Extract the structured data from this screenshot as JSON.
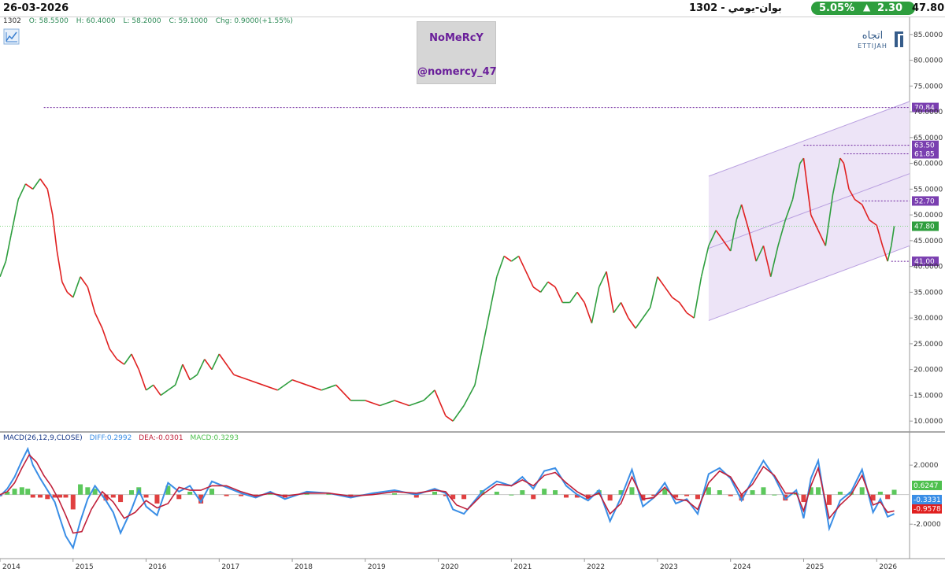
{
  "header": {
    "date": "26-03-2026",
    "symbol_code": "1302",
    "symbol_name": "بوان-يومي",
    "separator": "-",
    "change_pct": "5.05%",
    "change_value": "2.30",
    "last_price": "47.80"
  },
  "ohlc": {
    "symbol": "1302",
    "open": "O: 58.5500",
    "high": "H: 60.4000",
    "low": "L: 58.2000",
    "close": "C: 59.1000",
    "change": "Chg: 0.9000(+1.55%)"
  },
  "watermark": {
    "name": "NoMeRcY",
    "handle": "@nomercy_47"
  },
  "logo": {
    "arabic": "اتجاه",
    "latin": "ETTIJAH"
  },
  "macd_legend": {
    "title": "MACD(26,12,9,CLOSE)",
    "diff": "DIFF:0.2992",
    "dea": "DEA:-0.0301",
    "macd": "MACD:0.3293"
  },
  "colors": {
    "up": "#2e9e3e",
    "down": "#e02020",
    "level_line": "#6a1f9a",
    "channel_fill": "#ede4f7",
    "channel_line": "#b9a0e0",
    "diff_line": "#3a8ee6",
    "dea_line": "#c0203a",
    "badge_bg": "#2e9e3e"
  },
  "chart_data": [
    {
      "type": "line",
      "name": "price",
      "y_axis_ticks": [
        "85.0000",
        "80.0000",
        "75.0000",
        "70.0000",
        "65.0000",
        "60.0000",
        "55.0000",
        "50.0000",
        "45.0000",
        "40.0000",
        "35.0000",
        "30.0000",
        "25.0000",
        "20.0000",
        "15.0000",
        "10.0000"
      ],
      "ylim": [
        8.5,
        86.5
      ],
      "x_axis_labels": [
        "2014",
        "2015",
        "2016",
        "2017",
        "2018",
        "2019",
        "2020",
        "2021",
        "2022",
        "2023",
        "2024",
        "2025",
        "2026"
      ],
      "xlim": [
        2014.0,
        2026.45
      ],
      "series": [
        {
          "x": [
            2014.0,
            2014.08,
            2014.15,
            2014.25,
            2014.35,
            2014.45,
            2014.55,
            2014.65,
            2014.72,
            2014.78,
            2014.85,
            2014.92,
            2015.0,
            2015.1,
            2015.2,
            2015.3,
            2015.4,
            2015.5,
            2015.6,
            2015.7,
            2015.8,
            2015.9,
            2016.0,
            2016.1,
            2016.2,
            2016.3,
            2016.4,
            2016.5,
            2016.6,
            2016.7,
            2016.8,
            2016.9,
            2017.0,
            2017.2,
            2017.4,
            2017.6,
            2017.8,
            2018.0,
            2018.2,
            2018.4,
            2018.6,
            2018.8,
            2019.0,
            2019.2,
            2019.4,
            2019.6,
            2019.8,
            2019.95,
            2020.1,
            2020.2,
            2020.35,
            2020.5,
            2020.6,
            2020.7,
            2020.8,
            2020.9,
            2021.0,
            2021.1,
            2021.2,
            2021.3,
            2021.4,
            2021.5,
            2021.6,
            2021.7,
            2021.8,
            2021.9,
            2022.0,
            2022.1,
            2022.2,
            2022.3,
            2022.4,
            2022.5,
            2022.6,
            2022.7,
            2022.8,
            2022.9,
            2023.0,
            2023.1,
            2023.2,
            2023.3,
            2023.4,
            2023.5,
            2023.6,
            2023.7,
            2023.8,
            2023.9,
            2024.0,
            2024.08,
            2024.15,
            2024.25,
            2024.35,
            2024.45,
            2024.55,
            2024.65,
            2024.75,
            2024.85,
            2024.95,
            2025.0,
            2025.1,
            2025.2,
            2025.3,
            2025.4,
            2025.5,
            2025.55,
            2025.62,
            2025.7,
            2025.8,
            2025.9,
            2026.0,
            2026.08,
            2026.15,
            2026.2,
            2026.24
          ],
          "y": [
            38,
            41,
            46,
            53,
            56,
            55,
            57,
            55,
            50,
            43,
            37,
            35,
            34,
            38,
            36,
            31,
            28,
            24,
            22,
            21,
            23,
            20,
            16,
            17,
            15,
            16,
            17,
            21,
            18,
            19,
            22,
            20,
            23,
            19,
            18,
            17,
            16,
            18,
            17,
            16,
            17,
            14,
            14,
            13,
            14,
            13,
            14,
            16,
            11,
            10,
            13,
            17,
            24,
            31,
            38,
            42,
            41,
            42,
            39,
            36,
            35,
            37,
            36,
            33,
            33,
            35,
            33,
            29,
            36,
            39,
            31,
            33,
            30,
            28,
            30,
            32,
            38,
            36,
            34,
            33,
            31,
            30,
            38,
            44,
            47,
            45,
            43,
            49,
            52,
            47,
            41,
            44,
            38,
            44,
            49,
            53,
            60,
            61,
            50,
            47,
            44,
            54,
            61,
            60,
            55,
            53,
            52,
            49,
            48,
            44,
            41,
            44,
            47.8
          ]
        }
      ],
      "levels": [
        70.84,
        63.5,
        61.85,
        52.7,
        47.8,
        41.0
      ],
      "channel": {
        "x": [
          2023.7,
          2026.45
        ],
        "lower": [
          29.5,
          44.0
        ],
        "mid": [
          43.5,
          58.0
        ],
        "upper": [
          57.5,
          72.0
        ]
      }
    },
    {
      "type": "line",
      "name": "MACD(26,12,9,CLOSE)",
      "y_axis_ticks": [
        "2.0000",
        "-2.0000"
      ],
      "ylim": [
        -3.8,
        3.5
      ],
      "xlim": [
        2014.0,
        2026.45
      ],
      "series": [
        {
          "name": "DIFF",
          "x": [
            2014.0,
            2014.1,
            2014.2,
            2014.3,
            2014.38,
            2014.45,
            2014.55,
            2014.65,
            2014.75,
            2014.82,
            2014.9,
            2015.0,
            2015.1,
            2015.2,
            2015.3,
            2015.45,
            2015.55,
            2015.65,
            2015.8,
            2015.9,
            2016.0,
            2016.15,
            2016.3,
            2016.45,
            2016.6,
            2016.75,
            2016.9,
            2017.1,
            2017.3,
            2017.5,
            2017.7,
            2017.9,
            2018.2,
            2018.5,
            2018.8,
            2019.1,
            2019.4,
            2019.7,
            2019.95,
            2020.1,
            2020.2,
            2020.35,
            2020.6,
            2020.8,
            2021.0,
            2021.15,
            2021.3,
            2021.45,
            2021.6,
            2021.75,
            2021.9,
            2022.05,
            2022.2,
            2022.35,
            2022.5,
            2022.65,
            2022.8,
            2022.95,
            2023.1,
            2023.25,
            2023.4,
            2023.55,
            2023.7,
            2023.85,
            2024.0,
            2024.15,
            2024.3,
            2024.45,
            2024.6,
            2024.75,
            2024.9,
            2025.0,
            2025.1,
            2025.2,
            2025.35,
            2025.5,
            2025.65,
            2025.8,
            2025.95,
            2026.05,
            2026.15,
            2026.24
          ],
          "values": [
            -0.1,
            0.4,
            1.2,
            2.3,
            3.1,
            2.0,
            1.1,
            0.3,
            -0.5,
            -1.6,
            -2.8,
            -3.6,
            -1.8,
            -0.3,
            0.6,
            -0.4,
            -1.2,
            -2.6,
            -1.0,
            0.3,
            -0.8,
            -1.4,
            0.8,
            0.2,
            0.6,
            -0.5,
            0.9,
            0.5,
            0.1,
            -0.2,
            0.2,
            -0.3,
            0.2,
            0.1,
            -0.2,
            0.1,
            0.3,
            0.0,
            0.4,
            0.1,
            -1.0,
            -1.3,
            0.2,
            0.9,
            0.6,
            1.2,
            0.4,
            1.6,
            1.8,
            0.6,
            0.0,
            -0.4,
            0.3,
            -1.8,
            -0.2,
            1.7,
            -0.8,
            -0.2,
            0.8,
            -0.6,
            -0.3,
            -1.3,
            1.4,
            1.8,
            1.1,
            -0.4,
            1.0,
            2.3,
            1.2,
            -0.3,
            0.3,
            -1.6,
            1.1,
            2.3,
            -2.3,
            -0.4,
            0.2,
            1.7,
            -1.2,
            -0.3,
            -1.5,
            -1.3
          ]
        },
        {
          "name": "DEA",
          "x": [
            2014.0,
            2014.1,
            2014.2,
            2014.3,
            2014.4,
            2014.5,
            2014.6,
            2014.7,
            2014.8,
            2014.9,
            2015.0,
            2015.12,
            2015.25,
            2015.4,
            2015.55,
            2015.7,
            2015.85,
            2016.0,
            2016.15,
            2016.3,
            2016.45,
            2016.6,
            2016.75,
            2016.9,
            2017.1,
            2017.3,
            2017.5,
            2017.7,
            2017.9,
            2018.2,
            2018.5,
            2018.8,
            2019.1,
            2019.4,
            2019.7,
            2019.95,
            2020.1,
            2020.25,
            2020.4,
            2020.6,
            2020.8,
            2021.0,
            2021.15,
            2021.3,
            2021.45,
            2021.6,
            2021.75,
            2021.9,
            2022.05,
            2022.2,
            2022.35,
            2022.5,
            2022.65,
            2022.8,
            2022.95,
            2023.1,
            2023.25,
            2023.4,
            2023.55,
            2023.7,
            2023.85,
            2024.0,
            2024.15,
            2024.3,
            2024.45,
            2024.6,
            2024.75,
            2024.9,
            2025.0,
            2025.1,
            2025.2,
            2025.35,
            2025.5,
            2025.65,
            2025.8,
            2025.95,
            2026.05,
            2026.15,
            2026.24
          ],
          "values": [
            0.0,
            0.2,
            0.8,
            1.8,
            2.7,
            2.2,
            1.3,
            0.6,
            -0.3,
            -1.4,
            -2.6,
            -2.5,
            -1.0,
            0.2,
            -0.5,
            -1.6,
            -1.2,
            -0.4,
            -0.9,
            -0.6,
            0.5,
            0.3,
            0.3,
            0.6,
            0.6,
            0.2,
            -0.1,
            0.1,
            -0.1,
            0.1,
            0.1,
            -0.1,
            0.0,
            0.2,
            0.1,
            0.3,
            0.2,
            -0.7,
            -1.0,
            0.0,
            0.7,
            0.6,
            1.0,
            0.6,
            1.3,
            1.5,
            0.8,
            0.2,
            -0.2,
            0.1,
            -1.3,
            -0.6,
            1.2,
            -0.3,
            -0.2,
            0.5,
            -0.3,
            -0.4,
            -1.0,
            0.8,
            1.6,
            1.2,
            0.0,
            0.7,
            1.9,
            1.3,
            0.1,
            0.1,
            -1.1,
            0.6,
            1.8,
            -1.6,
            -0.7,
            0.0,
            1.3,
            -0.7,
            -0.5,
            -1.2,
            -1.1
          ]
        },
        {
          "name": "MACD",
          "x": [
            2014.0,
            2014.1,
            2014.2,
            2014.3,
            2014.38,
            2014.45,
            2014.55,
            2014.65,
            2014.75,
            2014.82,
            2014.9,
            2015.0,
            2015.1,
            2015.2,
            2015.3,
            2015.45,
            2015.55,
            2015.65,
            2015.8,
            2015.9,
            2016.0,
            2016.15,
            2016.3,
            2016.45,
            2016.6,
            2016.75,
            2016.9,
            2017.1,
            2017.3,
            2017.5,
            2017.7,
            2017.9,
            2018.2,
            2018.5,
            2018.8,
            2019.1,
            2019.4,
            2019.7,
            2019.95,
            2020.1,
            2020.2,
            2020.35,
            2020.6,
            2020.8,
            2021.0,
            2021.15,
            2021.3,
            2021.45,
            2021.6,
            2021.75,
            2021.9,
            2022.05,
            2022.2,
            2022.35,
            2022.5,
            2022.65,
            2022.8,
            2022.95,
            2023.1,
            2023.25,
            2023.4,
            2023.55,
            2023.7,
            2023.85,
            2024.0,
            2024.15,
            2024.3,
            2024.45,
            2024.6,
            2024.75,
            2024.9,
            2025.0,
            2025.1,
            2025.2,
            2025.35,
            2025.5,
            2025.65,
            2025.8,
            2025.95,
            2026.05,
            2026.15,
            2026.24
          ],
          "values": [
            -0.1,
            0.2,
            0.4,
            0.5,
            0.4,
            -0.2,
            -0.2,
            -0.3,
            -0.2,
            -0.2,
            -0.2,
            -1.0,
            0.7,
            0.5,
            0.4,
            -0.4,
            -0.2,
            -0.5,
            0.3,
            0.5,
            -0.2,
            -0.6,
            0.6,
            -0.3,
            0.2,
            -0.6,
            0.4,
            -0.1,
            -0.1,
            -0.2,
            0.1,
            -0.2,
            0.1,
            0.1,
            -0.2,
            0.1,
            0.1,
            -0.2,
            0.2,
            -0.1,
            -0.3,
            -0.3,
            0.3,
            0.2,
            0.0,
            0.3,
            -0.3,
            0.4,
            0.3,
            -0.2,
            -0.2,
            -0.3,
            0.3,
            -0.4,
            0.3,
            0.5,
            -0.4,
            -0.1,
            0.4,
            -0.2,
            -0.1,
            -0.3,
            0.5,
            0.3,
            -0.1,
            -0.4,
            0.3,
            0.5,
            0.0,
            -0.4,
            0.1,
            -0.5,
            0.5,
            0.5,
            -0.7,
            0.2,
            0.2,
            0.5,
            -0.4,
            0.2,
            -0.3,
            0.33
          ]
        }
      ],
      "levels": [
        0.6247,
        -0.9578,
        -0.3331
      ]
    }
  ]
}
